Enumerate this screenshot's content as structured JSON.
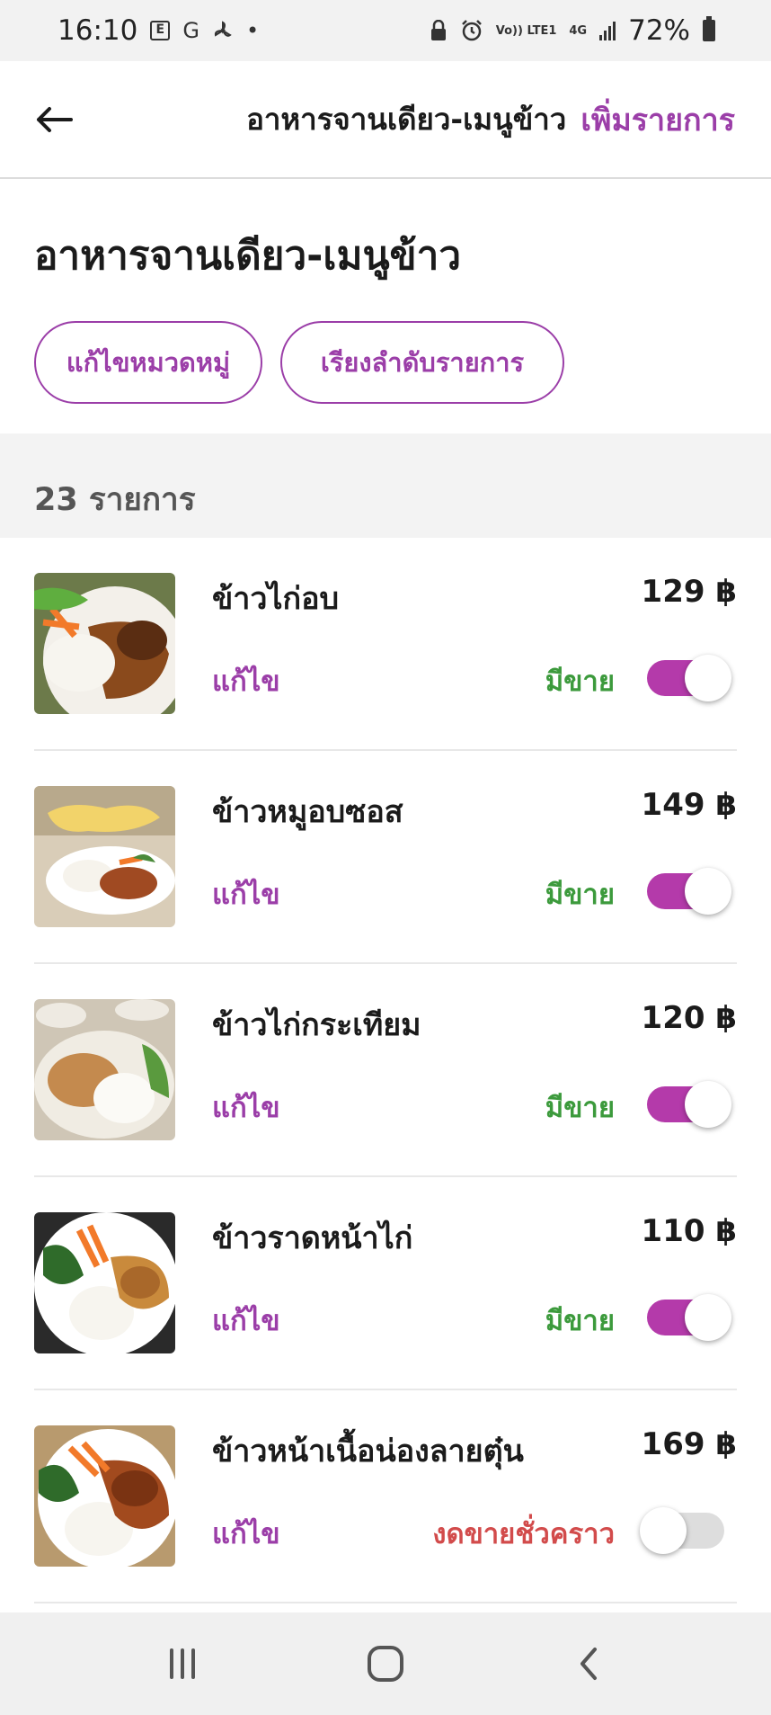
{
  "status_bar": {
    "time": "16:10",
    "network": "4G",
    "volte": "Vo)) LTE1",
    "battery": "72%",
    "icons": [
      "e-mail-app-icon",
      "google-icon",
      "fan-icon",
      "dot-icon",
      "lock-icon",
      "alarm-icon",
      "signal-icon",
      "battery-icon"
    ]
  },
  "header": {
    "title": "อาหารจานเดียว-เมนูข้าว",
    "action": "เพิ่มรายการ",
    "back_icon": "arrow-left-icon"
  },
  "category": {
    "title": "อาหารจานเดียว-เมนูข้าว",
    "edit_category": "แก้ไขหมวดหมู่",
    "sort_items": "เรียงลำดับรายการ"
  },
  "item_count": "23 รายการ",
  "items": [
    {
      "name": "ข้าวไก่อบ",
      "price": "129 ฿",
      "edit": "แก้ไข",
      "status": "มีขาย",
      "available": true
    },
    {
      "name": "ข้าวหมูอบซอส",
      "price": "149 ฿",
      "edit": "แก้ไข",
      "status": "มีขาย",
      "available": true
    },
    {
      "name": "ข้าวไก่กระเทียม",
      "price": "120 ฿",
      "edit": "แก้ไข",
      "status": "มีขาย",
      "available": true
    },
    {
      "name": "ข้าวราดหน้าไก่",
      "price": "110 ฿",
      "edit": "แก้ไข",
      "status": "มีขาย",
      "available": true
    },
    {
      "name": "ข้าวหน้าเนื้อน่องลายตุ๋น",
      "price": "169 ฿",
      "edit": "แก้ไข",
      "status": "งดขายชั่วคราว",
      "available": false
    }
  ],
  "colors": {
    "accent": "#9b3ea8",
    "toggle_on": "#b43aaa",
    "available": "#3c9a3c",
    "unavailable": "#d24b4b"
  },
  "nav_icons": [
    "recent-apps-icon",
    "home-icon",
    "back-icon"
  ]
}
